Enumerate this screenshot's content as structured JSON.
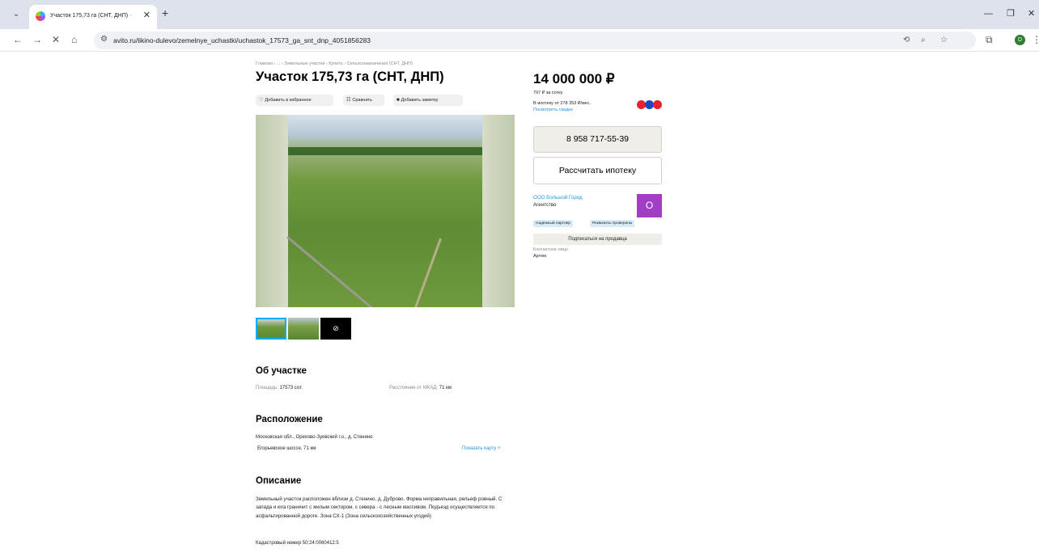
{
  "browser": {
    "tab_title": "Участок 175,73 га (СНТ, ДНП) · ",
    "tab_close": "✕",
    "new_tab": "+",
    "url": "avito.ru/likino-dulevo/zemelnye_uchastki/uchastok_17573_ga_snt_dnp_4051856283",
    "profile_initial": "D"
  },
  "listing": {
    "breadcrumb": "Главная › ... › Земельные участки › Купить › Сельхозназначения (СНТ, ДНП)",
    "title": "Участок 175,73 га (СНТ, ДНП)",
    "actions": {
      "favorite": "Добавить в избранное",
      "compare": "Сравнить",
      "note": "Добавить заметку"
    },
    "about": {
      "heading": "Об участке",
      "area_label": "Площадь: ",
      "area_value": "17573 сот.",
      "distance_label": "Расстояние от МКАД: ",
      "distance_value": "71 км"
    },
    "location": {
      "heading": "Расположение",
      "address": "Московская обл., Орехово-Зуевский г.о., д. Стенино",
      "road": "Егорьевское шоссе, 71 км",
      "show_map": "Показать карту ˅"
    },
    "description": {
      "heading": "Описание",
      "text": "Земельный участок расположен вблизи д. Стенино, д. Дуброво. Форма неправильная, рельеф ровный. С запада и юга граничит с жилым сектором, с севера - с лесным массивом. Подъезд осуществляется по асфальтированной дороге. Зона СХ-1 (Зона сельскохозяйственных угодий)",
      "cadastral": "Кадастровый номер 50:24:0060412:5"
    }
  },
  "sidebar": {
    "price": "14 000 000 ₽",
    "price_per_unit": "797 ₽ за сотку",
    "mortgage_text": "В ипотеку от 278 353 ₽/мес.",
    "discounts_link": "Посмотреть скидки",
    "phone": "8 958 717-55-39",
    "calc_mortgage": "Рассчитать ипотеку",
    "seller_name": "ООО Большой Город",
    "seller_type": "Агентство",
    "avatar_letter": "О",
    "tags": [
      "Надёжный партнёр",
      "Реквизиты проверены"
    ],
    "subscribe": "Подписаться на продавца",
    "contact_label": "Контактное лицо",
    "contact_name": "Артем"
  },
  "colors": {
    "accent": "#00aaff",
    "avatar": "#a03fc6",
    "link": "#1f95e8"
  }
}
